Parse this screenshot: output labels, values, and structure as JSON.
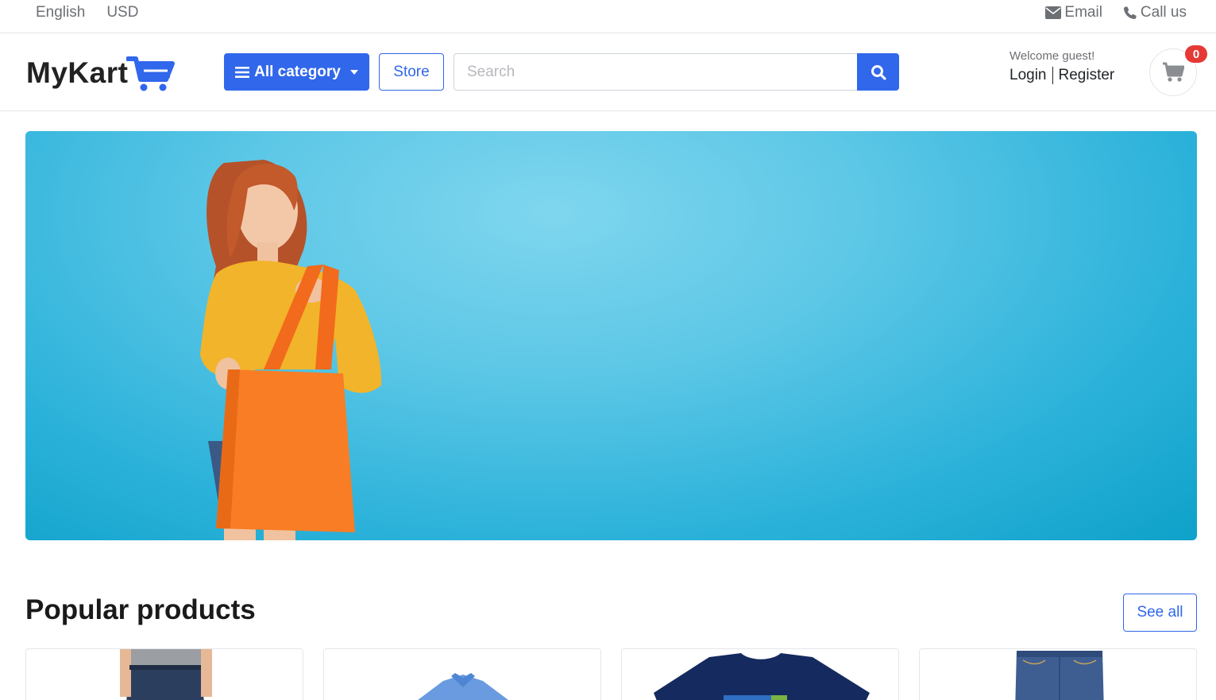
{
  "topbar": {
    "language": "English",
    "currency": "USD",
    "email_label": "Email",
    "call_label": "Call us"
  },
  "header": {
    "logo_text": "MyKart",
    "category_button": "All category",
    "store_button": "Store",
    "search_placeholder": "Search",
    "welcome_text": "Welcome guest!",
    "login_label": "Login",
    "register_label": "Register",
    "cart_count": "0"
  },
  "colors": {
    "primary": "#3167eb",
    "badge": "#e53935",
    "banner": "#4cc0e3"
  },
  "section": {
    "title": "Popular products",
    "see_all": "See all"
  },
  "products": [
    {
      "image": "jeans-model"
    },
    {
      "image": "blue-shirt"
    },
    {
      "image": "navy-tshirt"
    },
    {
      "image": "denim-jeans"
    }
  ]
}
